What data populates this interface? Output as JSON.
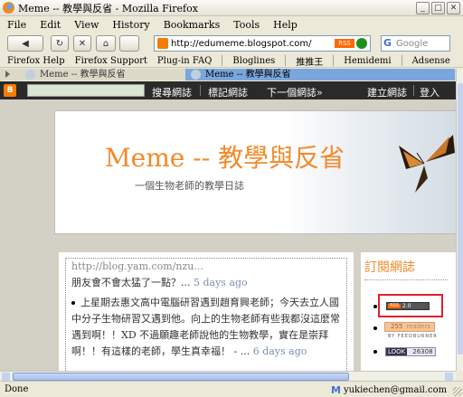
{
  "window": {
    "title": "Meme -- 教學與反省 - Mozilla Firefox",
    "minimize": "_",
    "maximize": "□",
    "close": "✕"
  },
  "menu": {
    "items": [
      {
        "label": "File"
      },
      {
        "label": "Edit"
      },
      {
        "label": "View"
      },
      {
        "label": "History"
      },
      {
        "label": "Bookmarks"
      },
      {
        "label": "Tools"
      },
      {
        "label": "Help"
      }
    ]
  },
  "navbar": {
    "back": "◀",
    "reload": "↻",
    "stop": "✕",
    "home": "⌂",
    "url": "http://edumeme.blogspot.com/",
    "rss_chip": "RSS",
    "search_placeholder": "Google"
  },
  "bookmarks": {
    "items": [
      {
        "label": "Firefox Help"
      },
      {
        "label": "Firefox Support"
      },
      {
        "label": "Plug-in FAQ"
      },
      {
        "label": "Bloglines"
      },
      {
        "label": "推推王"
      },
      {
        "label": "Hemidemi"
      },
      {
        "label": "Adsense"
      }
    ]
  },
  "tabs": [
    {
      "label": "Meme -- 教學與反省",
      "active": false
    },
    {
      "label": "Meme -- 教學與反省",
      "active": true
    }
  ],
  "blogger_bar": {
    "logo": "B",
    "search_blog": "搜尋網誌",
    "flag_blog": "標記網誌",
    "next_blog": "下一個網誌»",
    "create_blog": "建立網誌",
    "sign_in": "登入"
  },
  "blog": {
    "title": "Meme -- 教學與反省",
    "description": "一個生物老師的教學日誌"
  },
  "posts": {
    "item1_frag": "http://blog.yam.com/nzu...",
    "item1_text": "朋友會不會太猛了一點？...",
    "item1_time": "5 days ago",
    "item2_text": "上星期去惠文高中電腦研習遇到趙育興老師；今天去立人國中分子生物研習又遇到他。向上的生物老師有些我都沒這麼常遇到啊！！XD 不過願趣老師說他的生物教學，實在是崇拜啊！！有這樣的老師，學生真幸福！ - ...",
    "item2_time": "6 days ago"
  },
  "sidebar": {
    "title": "訂閱網誌",
    "rss_badge": "RSS",
    "rss_version": "2.0",
    "feed_count": "255",
    "feed_count_label": "readers",
    "feed_by": "BY FEEDBURNER",
    "rank_label": "LOOK",
    "rank_value": "26308"
  },
  "statusbar": {
    "text": "Done",
    "email": "yukiechen@gmail.com"
  },
  "colors": {
    "title_orange": "#f28a2b",
    "blogger_bar": "#2a2a2a",
    "active_tab": "#7aa6dd",
    "highlight_box": "#e0202a"
  }
}
